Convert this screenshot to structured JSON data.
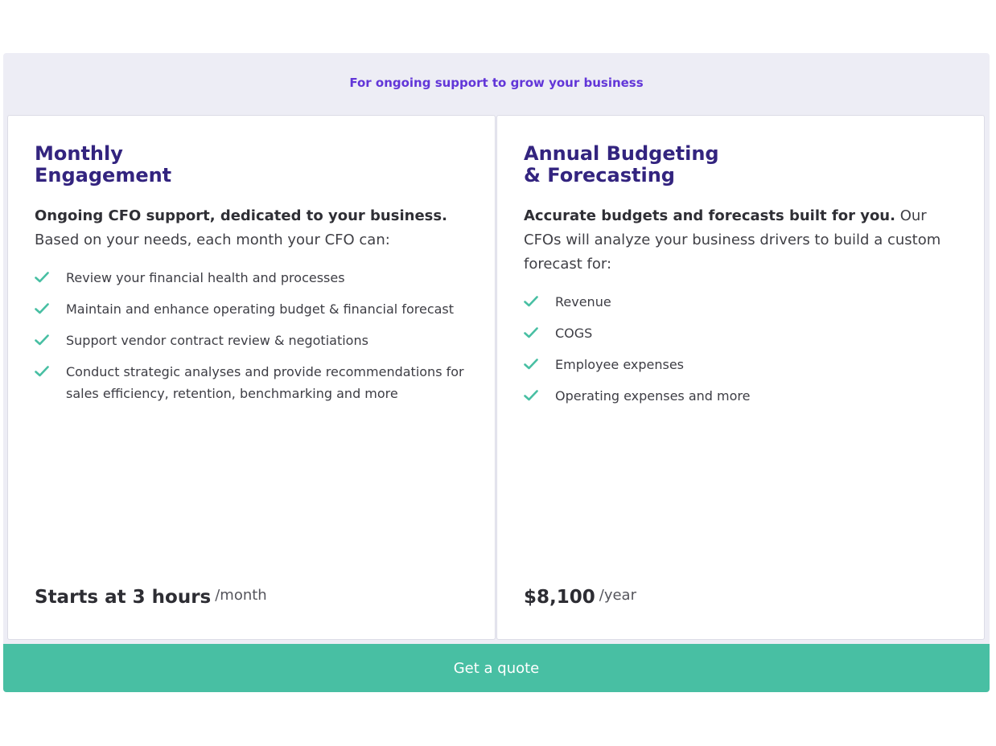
{
  "header": {
    "label": "For ongoing support to grow your business"
  },
  "colors": {
    "accent": "#6236d8",
    "title": "#33247f",
    "check": "#48bfa3",
    "cta": "#48bfa3"
  },
  "cards": [
    {
      "title_line1": "Monthly",
      "title_line2": "Engagement",
      "desc_bold": "Ongoing CFO support, dedicated to your business.",
      "desc_rest": " Based on your needs, each month your CFO can:",
      "features": [
        "Review your financial health and processes",
        "Maintain and enhance operating budget & financial forecast",
        "Support vendor contract review & negotiations",
        "Conduct strategic analyses and provide recommendations for sales efficiency, retention, benchmarking and more"
      ],
      "price": "Starts at 3 hours",
      "price_unit": "/month"
    },
    {
      "title_line1": "Annual Budgeting",
      "title_line2": "& Forecasting",
      "desc_bold": "Accurate budgets and forecasts built for you.",
      "desc_rest": " Our CFOs will analyze your business drivers to build a custom forecast for:",
      "features": [
        "Revenue",
        "COGS",
        "Employee expenses",
        "Operating expenses and more"
      ],
      "price": "$8,100",
      "price_unit": "/year"
    }
  ],
  "cta": {
    "label": "Get a quote"
  },
  "icons": {
    "feature_check": "check-icon"
  }
}
